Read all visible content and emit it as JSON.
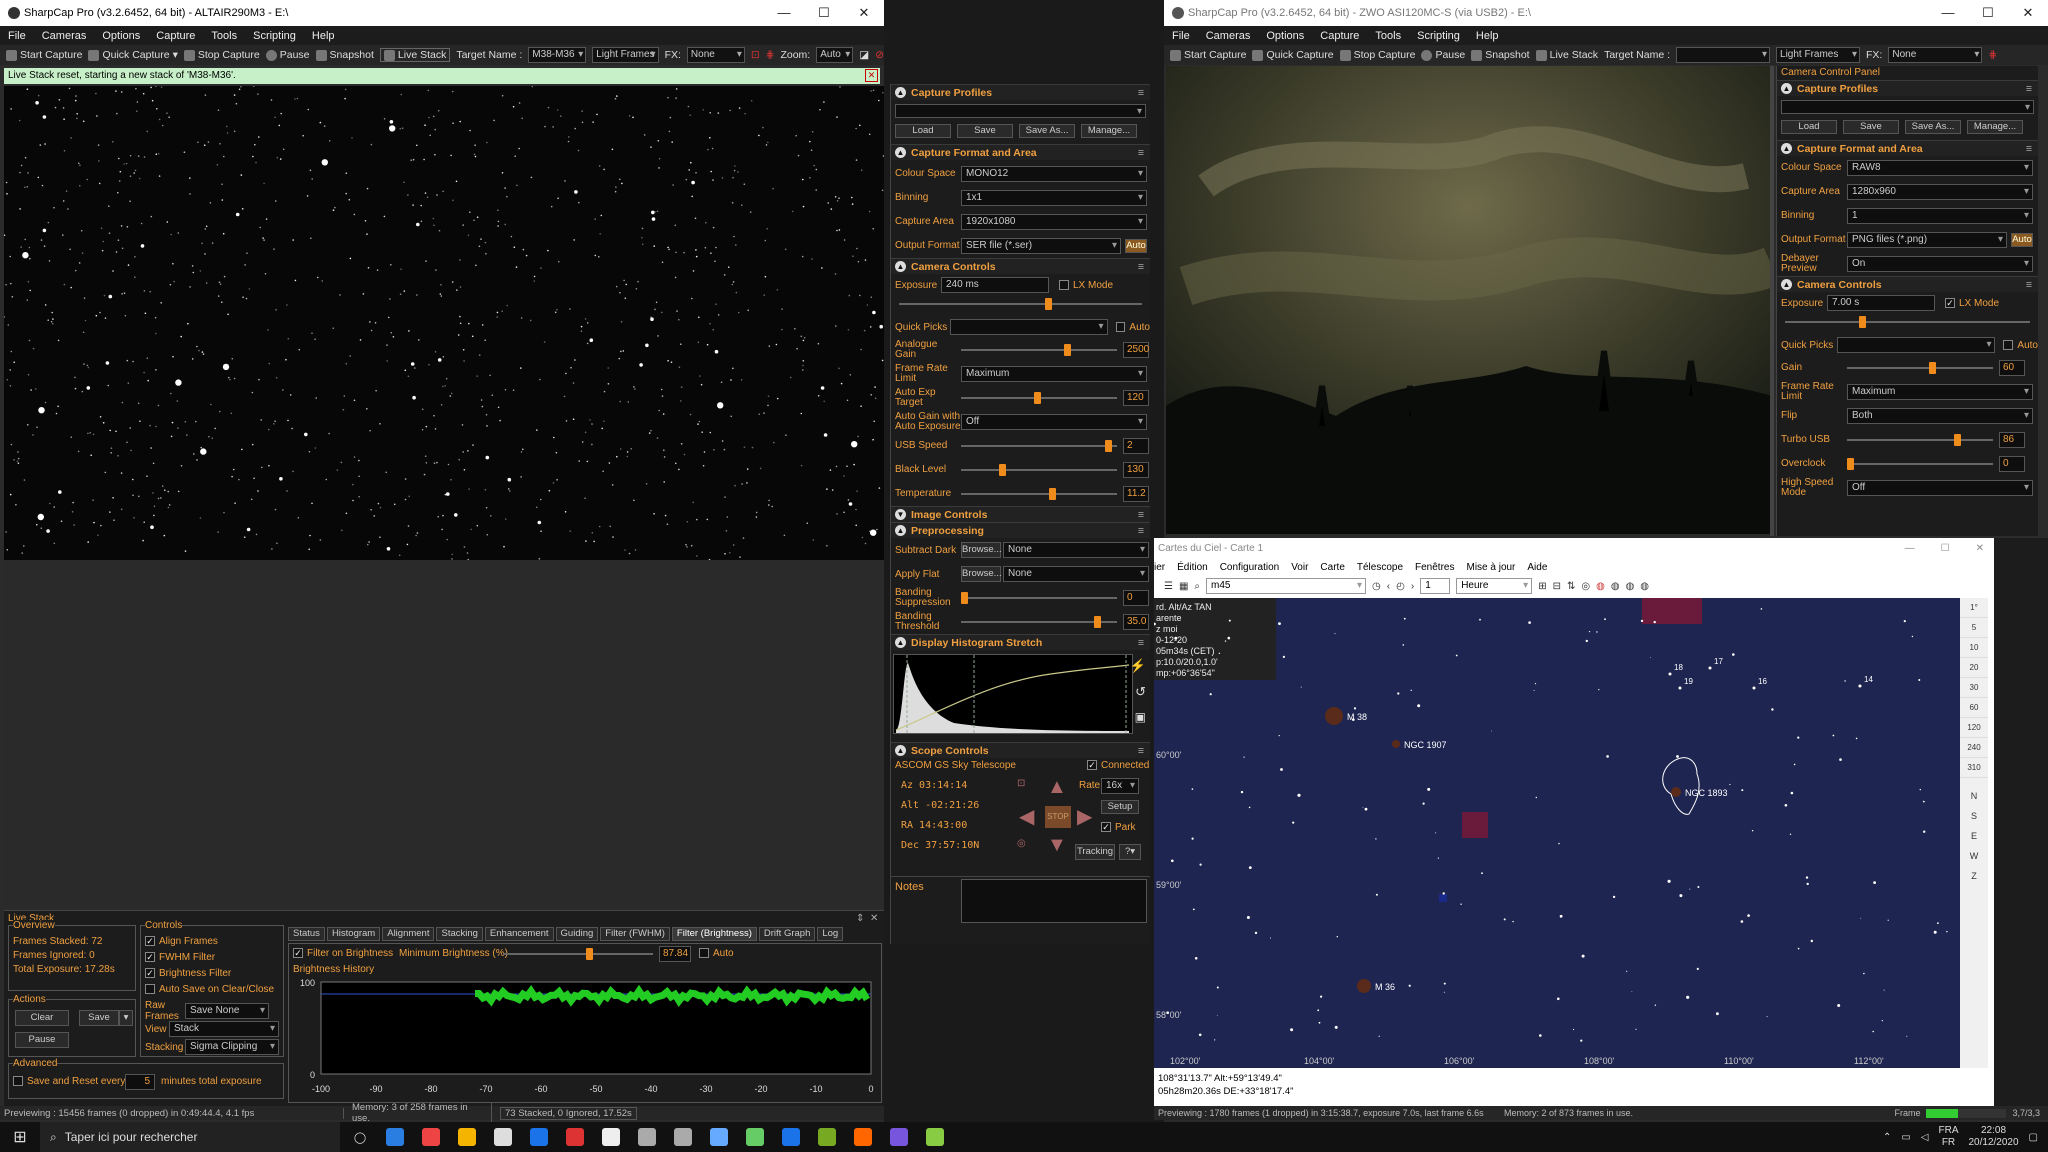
{
  "left": {
    "title": "SharpCap Pro (v3.2.6452, 64 bit) - ALTAIR290M3 - E:\\",
    "menu": [
      "File",
      "Cameras",
      "Options",
      "Capture",
      "Tools",
      "Scripting",
      "Help"
    ],
    "toolbar": {
      "start": "Start Capture",
      "quick": "Quick Capture",
      "stop": "Stop Capture",
      "pause": "Pause",
      "snapshot": "Snapshot",
      "live": "Live Stack",
      "target_label": "Target Name :",
      "target_value": "M38-M36",
      "frame_type": "Light Frames",
      "fx_label": "FX:",
      "fx_value": "None",
      "zoom_label": "Zoom:",
      "zoom_value": "Auto"
    },
    "notice": "Live Stack reset, starting a new stack of 'M38-M36'.",
    "profiles": {
      "title": "Capture Profiles",
      "buttons": [
        "Load",
        "Save",
        "Save As...",
        "Manage..."
      ]
    },
    "format": {
      "title": "Capture Format and Area",
      "rows": [
        {
          "label": "Colour Space",
          "value": "MONO12"
        },
        {
          "label": "Binning",
          "value": "1x1"
        },
        {
          "label": "Capture Area",
          "value": "1920x1080"
        },
        {
          "label": "Output Format",
          "value": "SER file (*.ser)"
        }
      ],
      "auto": "Auto"
    },
    "camera": {
      "title": "Camera Controls",
      "exposure_label": "Exposure",
      "exposure_value": "240 ms",
      "lx": "LX Mode",
      "quick_picks": "Quick Picks",
      "auto": "Auto",
      "sliders": [
        {
          "label": "Analogue Gain",
          "value": "2500",
          "pos": 0.7
        },
        {
          "label": "Frame Rate Limit",
          "value": "Maximum",
          "dd": true
        },
        {
          "label": "Auto Exp Target",
          "value": "120",
          "pos": 0.5
        },
        {
          "label": "Auto Gain with Auto Exposure",
          "value": "Off",
          "dd": true
        },
        {
          "label": "USB Speed",
          "value": "2",
          "pos": 0.98
        },
        {
          "label": "Black Level",
          "value": "130",
          "pos": 0.26
        },
        {
          "label": "Temperature",
          "value": "11.2",
          "pos": 0.6
        }
      ]
    },
    "image_controls": "Image Controls",
    "prep": {
      "title": "Preprocessing",
      "subtract": "Subtract Dark",
      "flat": "Apply Flat",
      "browse": "Browse...",
      "none": "None",
      "banding_sup": "Banding Suppression",
      "banding_sup_val": "0",
      "banding_thr": "Banding Threshold",
      "banding_thr_val": "35.0"
    },
    "histo": "Display Histogram Stretch",
    "scope": {
      "title": "Scope Controls",
      "name": "ASCOM GS Sky Telescope",
      "connected": "Connected",
      "rate_label": "Rate:",
      "rate": "16x",
      "setup": "Setup",
      "park": "Park",
      "tracking": "Tracking",
      "stop": "STOP",
      "az": "Az  03:14:14",
      "alt": "Alt -02:21:26",
      "ra": "RA  14:43:00",
      "dec": "Dec 37:57:10N"
    },
    "notes": "Notes",
    "ls": {
      "title": "Live Stack",
      "overview": "Overview",
      "stacked": "Frames Stacked: 72",
      "ignored": "Frames Ignored:  0",
      "total": "Total Exposure:   17.28s",
      "actions": "Actions",
      "clear": "Clear",
      "save": "Save",
      "pause": "Pause",
      "advanced": "Advanced",
      "save_reset": "Save and Reset every",
      "minutes": "minutes total exposure",
      "min_val": "5",
      "controls": "Controls",
      "align": "Align Frames",
      "fwhm": "FWHM Filter",
      "bright": "Brightness Filter",
      "autosave": "Auto Save on Clear/Close",
      "raw": "Raw Frames",
      "raw_v": "Save None",
      "view": "View",
      "view_v": "Stack",
      "stacking": "Stacking",
      "stacking_v": "Sigma Clipping",
      "tabs": [
        "Status",
        "Histogram",
        "Alignment",
        "Stacking",
        "Enhancement",
        "Guiding",
        "Filter (FWHM)",
        "Filter (Brightness)",
        "Drift Graph",
        "Log"
      ],
      "filter_on": "Filter on Brightness",
      "min_b": "Minimum Brightness (%)",
      "min_b_val": "87.84",
      "auto": "Auto",
      "bh": "Brightness History",
      "chart_y": [
        "100",
        "0"
      ],
      "chart_x": [
        "-100",
        "-90",
        "-80",
        "-70",
        "-60",
        "-50",
        "-40",
        "-30",
        "-20",
        "-10",
        "0"
      ]
    },
    "status": {
      "a": "Previewing : 15456 frames (0 dropped) in 0:49:44.4, 4.1 fps",
      "b": "Memory: 3 of 258 frames in use.",
      "c": "73 Stacked, 0 Ignored, 17.52s"
    }
  },
  "right": {
    "title": "SharpCap Pro (v3.2.6452, 64 bit) - ZWO ASI120MC-S (via USB2) - E:\\",
    "menu": [
      "File",
      "Cameras",
      "Options",
      "Capture",
      "Tools",
      "Scripting",
      "Help"
    ],
    "toolbar": {
      "start": "Start Capture",
      "quick": "Quick Capture",
      "stop": "Stop Capture",
      "pause": "Pause",
      "snapshot": "Snapshot",
      "live": "Live Stack",
      "target_label": "Target Name :",
      "frame_type": "Light Frames",
      "fx_label": "FX:",
      "fx_value": "None"
    },
    "ccp": "Camera Control Panel",
    "profiles": {
      "title": "Capture Profiles",
      "buttons": [
        "Load",
        "Save",
        "Save As...",
        "Manage..."
      ]
    },
    "format": {
      "title": "Capture Format and Area",
      "rows": [
        {
          "label": "Colour Space",
          "value": "RAW8"
        },
        {
          "label": "Capture Area",
          "value": "1280x960"
        },
        {
          "label": "Binning",
          "value": "1"
        },
        {
          "label": "Output Format",
          "value": "PNG files (*.png)"
        },
        {
          "label": "Debayer Preview",
          "value": "On"
        }
      ],
      "auto": "Auto"
    },
    "camera": {
      "title": "Camera Controls",
      "exposure_label": "Exposure",
      "exposure_value": "7.00 s",
      "lx": "LX Mode",
      "quick_picks": "Quick Picks",
      "auto": "Auto",
      "rows": [
        {
          "label": "Gain",
          "value": "60",
          "pos": 0.6
        },
        {
          "label": "Frame Rate Limit",
          "value": "Maximum",
          "dd": true
        },
        {
          "label": "Flip",
          "value": "Both",
          "dd": true
        },
        {
          "label": "Turbo USB",
          "value": "86",
          "pos": 0.78
        },
        {
          "label": "Overclock",
          "value": "0",
          "pos": 0.0
        },
        {
          "label": "High Speed Mode",
          "value": "Off",
          "dd": true
        }
      ]
    },
    "status": "Previewing : 1780 frames (1 dropped) in 3:15:38.7, exposure 7.0s, last frame 6.6s",
    "status_b": "Memory: 2 of 873 frames in use.",
    "status_c": "Frame",
    "status_d": "3,7/3,3"
  },
  "cdc": {
    "title": "Cartes du Ciel - Carte 1",
    "menu": [
      "ier",
      "Édition",
      "Configuration",
      "Voir",
      "Carte",
      "Télescope",
      "Fenêtres",
      "Mise à jour",
      "Aide"
    ],
    "search": "m45",
    "step": "1",
    "unit": "Heure",
    "info": [
      "rd. Alt/Az TAN",
      "arente",
      "z moi",
      "0-12-20",
      "05m34s (CET)",
      "p:10.0/20.0,1.0'",
      "mp:+06°36'54\""
    ],
    "objects": {
      "m38": "M 38",
      "ngc1907": "NGC 1907",
      "ngc1893": "NGC 1893",
      "m36": "M 36"
    },
    "stars": [
      "18",
      "17",
      "19",
      "16",
      "14"
    ],
    "dec": [
      "60°00'",
      "59°00'",
      "58°00'"
    ],
    "ra": [
      "102°00'",
      "104°00'",
      "106°00'",
      "108°00'",
      "110°00'",
      "112°00'"
    ],
    "status_a": "108°31'13.7\" Alt:+59°13'49.4\"",
    "status_b": "05h28m20.36s DE:+33°18'17.4\"",
    "right_scale": [
      "1°",
      "5",
      "10",
      "20",
      "30",
      "60",
      "120",
      "240",
      "310"
    ],
    "compass": [
      "N",
      "S",
      "E",
      "W",
      "Z"
    ]
  },
  "taskbar": {
    "search": "Taper ici pour rechercher",
    "lang": "FRA",
    "lang2": "FR",
    "time": "22:08",
    "date": "20/12/2020"
  }
}
